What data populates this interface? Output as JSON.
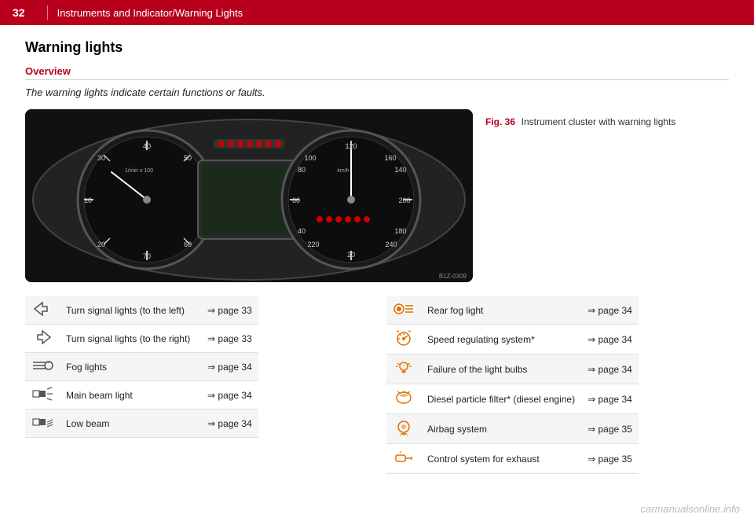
{
  "header": {
    "page_number": "32",
    "title": "Instruments and Indicator/Warning Lights"
  },
  "section": {
    "heading": "Warning lights",
    "sub_heading": "Overview",
    "intro_text": "The warning lights indicate certain functions or faults.",
    "figure_label": "Fig. 36",
    "figure_caption": "Instrument cluster with warning lights",
    "img_ref": "B1Z-0309"
  },
  "left_table": {
    "rows": [
      {
        "icon": "turn_left",
        "label": "Turn signal lights (to the left)",
        "page_ref": "⇒ page 33"
      },
      {
        "icon": "turn_right",
        "label": "Turn signal lights (to the right)",
        "page_ref": "⇒ page 33"
      },
      {
        "icon": "fog",
        "label": "Fog lights",
        "page_ref": "⇒ page 34"
      },
      {
        "icon": "main_beam",
        "label": "Main beam light",
        "page_ref": "⇒ page 34"
      },
      {
        "icon": "low_beam",
        "label": "Low beam",
        "page_ref": "⇒ page 34"
      }
    ]
  },
  "right_table": {
    "rows": [
      {
        "icon": "rear_fog",
        "label": "Rear fog light",
        "page_ref": "⇒ page 34"
      },
      {
        "icon": "speed_reg",
        "label": "Speed regulating system*",
        "page_ref": "⇒ page 34"
      },
      {
        "icon": "bulb_fail",
        "label": "Failure of the light bulbs",
        "page_ref": "⇒ page 34"
      },
      {
        "icon": "diesel",
        "label": "Diesel particle filter* (diesel engine)",
        "page_ref": "⇒ page 34"
      },
      {
        "icon": "airbag",
        "label": "Airbag system",
        "page_ref": "⇒ page 35"
      },
      {
        "icon": "exhaust",
        "label": "Control system for exhaust",
        "page_ref": "⇒ page 35"
      }
    ]
  },
  "watermark": "carmanualsonline.info"
}
